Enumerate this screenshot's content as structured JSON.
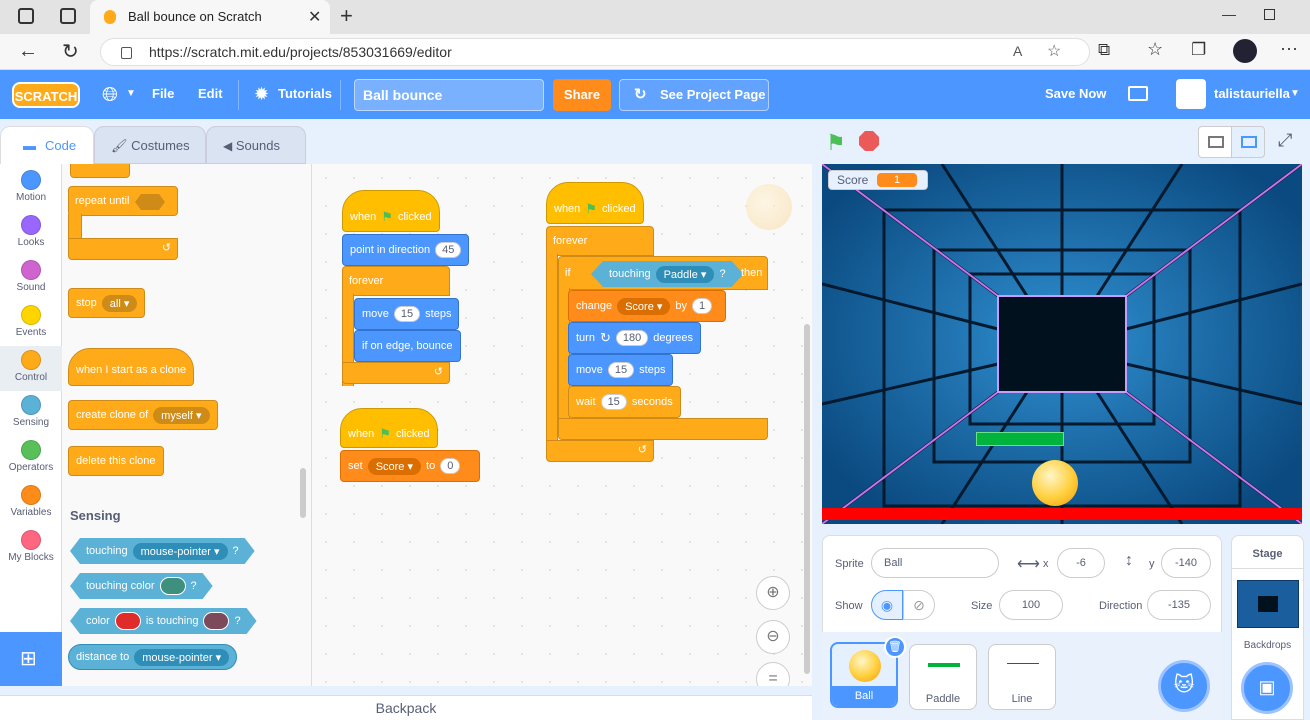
{
  "browser": {
    "tab_title": "Ball bounce on Scratch",
    "url": "https://scratch.mit.edu/projects/853031669/editor"
  },
  "menu": {
    "logo": "SCRATCH",
    "file": "File",
    "edit": "Edit",
    "tutorials": "Tutorials",
    "project_title": "Ball bounce",
    "share": "Share",
    "see_project_page": "See Project Page",
    "save_now": "Save Now",
    "username": "talistauriella"
  },
  "editor_tabs": {
    "code": "Code",
    "costumes": "Costumes",
    "sounds": "Sounds"
  },
  "categories": [
    {
      "label": "Motion",
      "color": "#4c97ff"
    },
    {
      "label": "Looks",
      "color": "#9966ff"
    },
    {
      "label": "Sound",
      "color": "#cf63cf"
    },
    {
      "label": "Events",
      "color": "#ffd500"
    },
    {
      "label": "Control",
      "color": "#ffab19"
    },
    {
      "label": "Sensing",
      "color": "#5cb1d6"
    },
    {
      "label": "Operators",
      "color": "#59c059"
    },
    {
      "label": "Variables",
      "color": "#ff8c1a"
    },
    {
      "label": "My Blocks",
      "color": "#ff6680"
    }
  ],
  "palette": {
    "repeat_until": "repeat until",
    "stop": "stop",
    "stop_value": "all",
    "when_clone": "when I start as a clone",
    "create_clone": "create clone of",
    "create_clone_value": "myself",
    "delete_clone": "delete this clone",
    "sensing_heading": "Sensing",
    "touching": "touching",
    "touching_value": "mouse-pointer",
    "question": "?",
    "touching_color": "touching color",
    "color": "color",
    "is_touching": "is touching",
    "distance_to": "distance to",
    "distance_value": "mouse-pointer"
  },
  "scripts": {
    "when": "when",
    "clicked": "clicked",
    "point_in_direction": "point in direction",
    "direction_value": "45",
    "forever": "forever",
    "move": "move",
    "steps": "steps",
    "move_value": "15",
    "if_on_edge": "if on edge, bounce",
    "set": "set",
    "score_var": "Score",
    "to": "to",
    "set_value": "0",
    "if": "if",
    "then": "then",
    "touching": "touching",
    "paddle": "Paddle",
    "question": "?",
    "change": "change",
    "by": "by",
    "change_value": "1",
    "turn": "turn",
    "degrees": "degrees",
    "turn_value": "180",
    "move2_value": "15",
    "wait": "wait",
    "seconds": "seconds",
    "wait_value": "15"
  },
  "backpack": "Backpack",
  "stage": {
    "score_label": "Score",
    "score_value": "1"
  },
  "sprite_info": {
    "sprite_label": "Sprite",
    "sprite_name": "Ball",
    "x_label": "x",
    "x_value": "-6",
    "y_label": "y",
    "y_value": "-140",
    "show_label": "Show",
    "size_label": "Size",
    "size_value": "100",
    "direction_label": "Direction",
    "direction_value": "-135"
  },
  "sprites": [
    {
      "name": "Ball"
    },
    {
      "name": "Paddle"
    },
    {
      "name": "Line"
    }
  ],
  "stage_pane": {
    "title": "Stage",
    "backdrops": "Backdrops"
  }
}
